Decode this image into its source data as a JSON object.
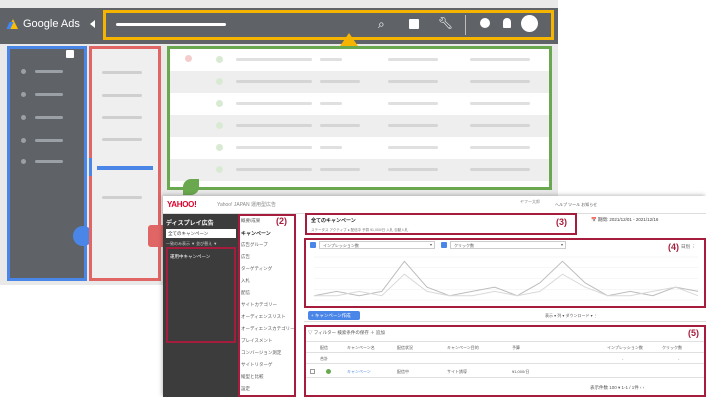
{
  "google_ads": {
    "brand": "Google Ads"
  },
  "yahoo_ads": {
    "logo": "YAHOO!",
    "account": "Yahoo! JAPAN   運用型広告",
    "user": "ヤフー太郎",
    "header_links": "ヘルプ  ツール  お知らせ",
    "sidebar": {
      "title": "ディスプレイ広告",
      "all_campaigns": "全てのキャンペーン",
      "filter": "一致のみ表示  ▼   並び替え ▼",
      "campaign_item": "運用中キャンペーン"
    },
    "menu": {
      "items": [
        "概要/成果",
        "キャンペーン",
        "広告グループ",
        "広告",
        "ターゲティング",
        "入札",
        "配信",
        "サイトカテゴリー",
        "オーディエンスリスト",
        "オーディエンスカテゴリー",
        "プレイスメント",
        "コンバージョン測定",
        "サイトリターゲ",
        "縦型と比較",
        "設定"
      ],
      "active_index": 1
    },
    "labels": {
      "n2": "(2)",
      "n3": "(3)",
      "n4": "(4)",
      "n5": "(5)"
    },
    "page_title": "全てのキャンペーン",
    "status_line": "ステータス   アクティブ   ● 配信中   予算   ¥1,000/日   入札   自動入札",
    "date_range": "📅 期間: 2021/12/01 - 2021/12/16",
    "chart_selects": [
      "インプレッション数",
      "クリック数"
    ],
    "chart_tools": "日別  ⋮",
    "create_button": "+ キャンペーン作成",
    "toolbar_tools": "表示  ▾   列  ▾   ダウンロード  ▾   ⋮",
    "filter_row": "▽ フィルター     検索条件の保存    ＋ 追加",
    "table": {
      "headers": [
        "配信",
        "キャンペーン名",
        "配信状況",
        "キャンペーン目的",
        "予算",
        "インプレッション数",
        "クリック数"
      ],
      "total_label": "合計",
      "total_values": [
        "-",
        "-"
      ],
      "row": {
        "name": "キャンペーン",
        "status": "配信中",
        "objective": "サイト誘導",
        "budget": "¥1,000/日"
      }
    },
    "pager": "表示件数  100 ▾    1-1 / 1件    ‹  ›"
  },
  "chart_data": {
    "type": "line",
    "series": [
      {
        "values": [
          1,
          2,
          1,
          2,
          9,
          3,
          1,
          2,
          3,
          1,
          4,
          9,
          4,
          1,
          2,
          1,
          3,
          2
        ]
      },
      {
        "values": [
          1,
          1,
          2,
          1,
          6,
          2,
          1,
          1,
          2,
          1,
          2,
          6,
          3,
          1,
          1,
          2,
          3,
          1
        ]
      }
    ],
    "ylim": [
      0,
      10
    ]
  }
}
